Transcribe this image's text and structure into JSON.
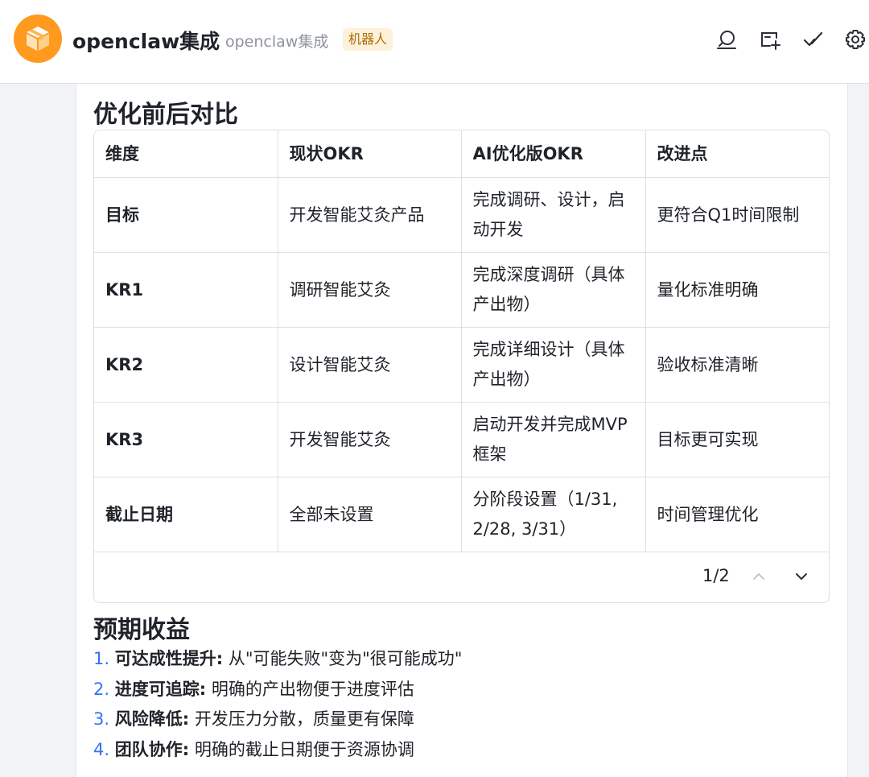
{
  "header": {
    "title": "openclaw集成",
    "subtitle": "openclaw集成",
    "badge": "机器人",
    "accent_color": "#ff9a1f",
    "avatar_icon": "box-icon",
    "actions": [
      "search-chat-icon",
      "add-tab-icon",
      "checkmark-icon",
      "gear-icon"
    ]
  },
  "section1": {
    "heading": "优化前后对比"
  },
  "table": {
    "headers": [
      "维度",
      "现状OKR",
      "AI优化版OKR",
      "改进点"
    ],
    "rows": [
      [
        "目标",
        "开发智能艾灸产品",
        "完成调研、设计，启动开发",
        "更符合Q1时间限制"
      ],
      [
        "KR1",
        "调研智能艾灸",
        "完成深度调研（具体产出物）",
        "量化标准明确"
      ],
      [
        "KR2",
        "设计智能艾灸",
        "完成详细设计（具体产出物）",
        "验收标准清晰"
      ],
      [
        "KR3",
        "开发智能艾灸",
        "启动开发并完成MVP框架",
        "目标更可实现"
      ],
      [
        "截止日期",
        "全部未设置",
        "分阶段设置（1/31, 2/28, 3/31）",
        "时间管理优化"
      ]
    ],
    "pager": {
      "text": "1/2"
    }
  },
  "section2": {
    "heading": "预期收益",
    "items": [
      {
        "num": "1.",
        "title": "可达成性提升:",
        "text": " 从\"可能失败\"变为\"很可能成功\""
      },
      {
        "num": "2.",
        "title": "进度可追踪:",
        "text": " 明确的产出物便于进度评估"
      },
      {
        "num": "3.",
        "title": "风险降低:",
        "text": " 开发压力分散，质量更有保障"
      },
      {
        "num": "4.",
        "title": "团队协作:",
        "text": " 明确的截止日期便于资源协调"
      }
    ]
  }
}
